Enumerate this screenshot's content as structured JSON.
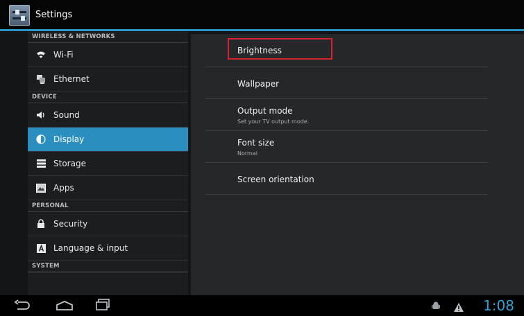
{
  "actionbar": {
    "title": "Settings",
    "icon": "settings-icon"
  },
  "sidebar": {
    "sections": [
      {
        "header": "WIRELESS & NETWORKS",
        "items": [
          {
            "label": "Wi-Fi",
            "icon": "wifi-icon"
          },
          {
            "label": "Ethernet",
            "icon": "ethernet-icon"
          }
        ]
      },
      {
        "header": "DEVICE",
        "items": [
          {
            "label": "Sound",
            "icon": "speaker-icon"
          },
          {
            "label": "Display",
            "icon": "display-icon",
            "selected": true
          },
          {
            "label": "Storage",
            "icon": "storage-icon"
          },
          {
            "label": "Apps",
            "icon": "apps-icon"
          }
        ]
      },
      {
        "header": "PERSONAL",
        "items": [
          {
            "label": "Security",
            "icon": "lock-icon"
          },
          {
            "label": "Language & input",
            "icon": "keyboard-icon"
          }
        ]
      },
      {
        "header": "SYSTEM",
        "items": []
      }
    ]
  },
  "display": {
    "prefs": [
      {
        "title": "Brightness",
        "summary": ""
      },
      {
        "title": "Wallpaper",
        "summary": ""
      },
      {
        "title": "Output mode",
        "summary": "Set your TV output mode."
      },
      {
        "title": "Font size",
        "summary": "Normal"
      },
      {
        "title": "Screen orientation",
        "summary": ""
      }
    ]
  },
  "navbar": {
    "clock": "1:08"
  },
  "colors": {
    "accent": "#2a8fbf",
    "highlight": "#d6232e",
    "clock": "#33a3d5"
  }
}
